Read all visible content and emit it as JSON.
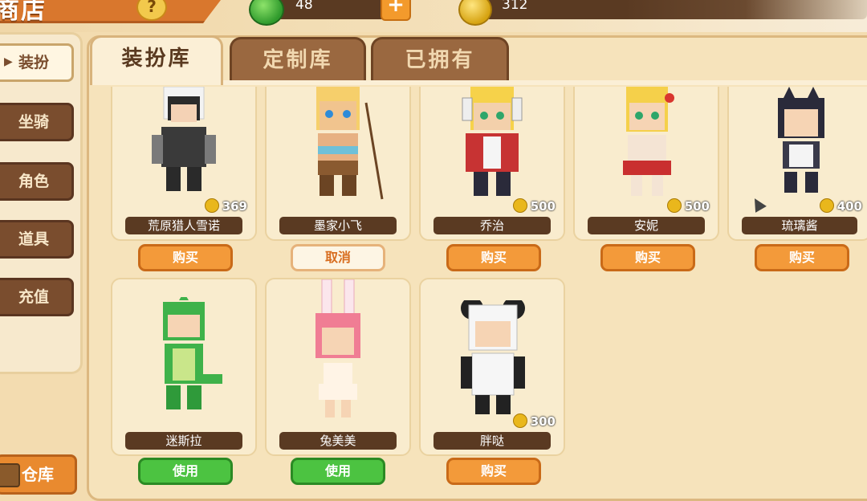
{
  "header": {
    "title": "商店",
    "currencies": [
      {
        "icon": "gem-icon",
        "amount": "48"
      },
      {
        "icon": "coin-icon",
        "amount": "312"
      }
    ],
    "plus_label": "+",
    "help_label": "?"
  },
  "sidebar": {
    "items": [
      {
        "label": "装扮",
        "active": true
      },
      {
        "label": "坐骑",
        "active": false
      },
      {
        "label": "角色",
        "active": false
      },
      {
        "label": "道具",
        "active": false
      },
      {
        "label": "充值",
        "active": false
      }
    ],
    "warehouse_label": "仓库"
  },
  "tabs": [
    {
      "label": "装扮库",
      "active": true
    },
    {
      "label": "定制库",
      "active": false
    },
    {
      "label": "已拥有",
      "active": false
    }
  ],
  "items": [
    {
      "name": "荒原猎人雪诺",
      "price": "369",
      "action": "购买",
      "action_type": "buy"
    },
    {
      "name": "墨家小飞",
      "price": "",
      "action": "取消",
      "action_type": "cancel"
    },
    {
      "name": "乔治",
      "price": "500",
      "action": "购买",
      "action_type": "buy"
    },
    {
      "name": "安妮",
      "price": "500",
      "action": "购买",
      "action_type": "buy"
    },
    {
      "name": "琉璃酱",
      "price": "400",
      "action": "购买",
      "action_type": "buy"
    },
    {
      "name": "迷斯拉",
      "price": "",
      "action": "使用",
      "action_type": "use"
    },
    {
      "name": "兔美美",
      "price": "",
      "action": "使用",
      "action_type": "use"
    },
    {
      "name": "胖哒",
      "price": "300",
      "action": "购买",
      "action_type": "buy"
    }
  ],
  "colors": {
    "accent": "#f39a3a",
    "panel": "#f6e3bb",
    "dark": "#5a3a22",
    "use": "#4cc341"
  }
}
